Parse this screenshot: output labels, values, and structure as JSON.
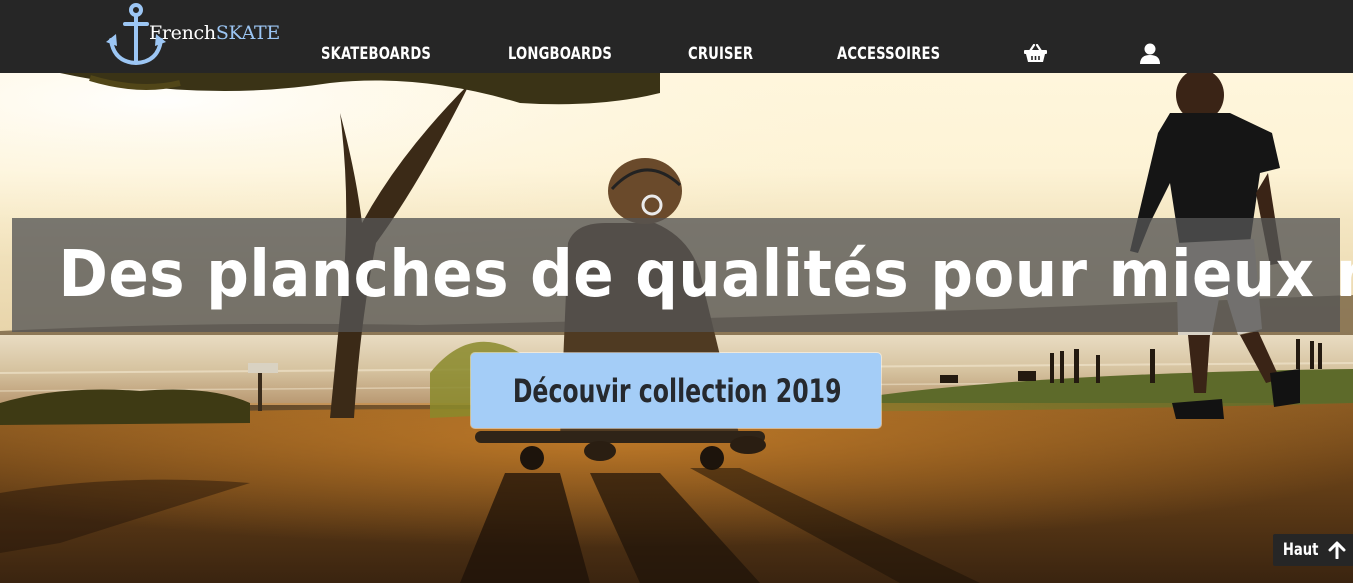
{
  "brand": {
    "part1": "French",
    "part2": "SKATE"
  },
  "nav": {
    "links": [
      "SKATEBOARDS",
      "LONGBOARDS",
      "CRUISER",
      "ACCESSOIRES"
    ],
    "cart_icon": "basket-icon",
    "account_icon": "user-icon"
  },
  "hero": {
    "headline": "Des planches de qualités pour mieux rider",
    "cta_label": "Découvir collection 2019"
  },
  "back_to_top": {
    "label": "Haut",
    "icon": "arrow-up-icon"
  },
  "colors": {
    "nav_bg": "#262626",
    "accent": "#a4cdf7",
    "brand_accent": "#9cc6f4"
  }
}
